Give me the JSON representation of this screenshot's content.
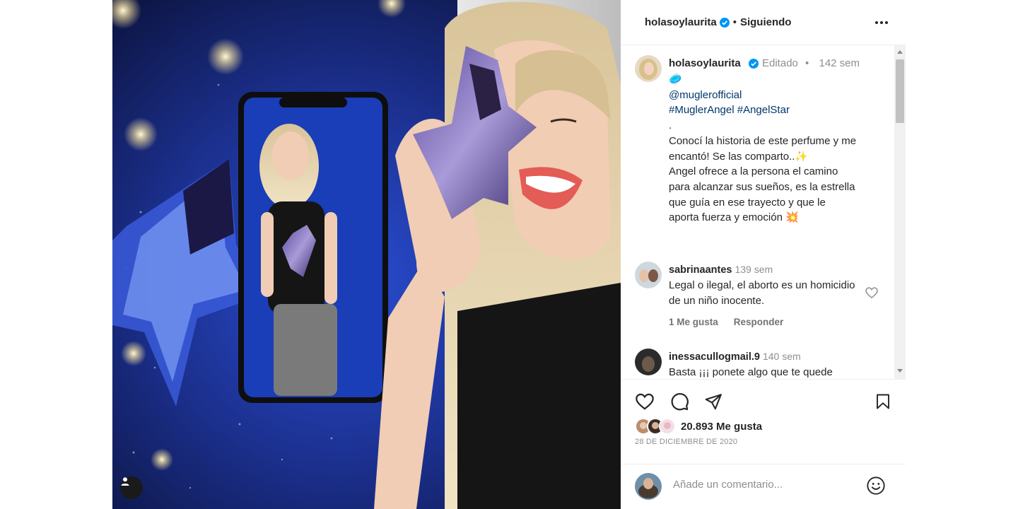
{
  "header": {
    "username": "holasoylaurita",
    "separator": "•",
    "follow_status": "Siguiendo",
    "more_icon": "more-horizontal-icon"
  },
  "caption": {
    "username": "holasoylaurita",
    "edited": "Editado",
    "separator": "•",
    "time": "142 sem",
    "lines": {
      "emoji": "🥏",
      "mention": "@muglerofficial",
      "hashtags": "#MuglerAngel #AngelStar",
      "dot": ".",
      "l1": "Conocí la historia de este perfume y me",
      "l2": "encantó! Se las comparto..✨",
      "l3": "Angel ofrece a la persona el camino",
      "l4": "para alcanzar sus sueños, es la estrella",
      "l5": "que guía en ese trayecto y que le",
      "l6": "aporta fuerza y emoción 💥"
    }
  },
  "comments": [
    {
      "username": "sabrinaantes",
      "time": "139 sem",
      "text": "Legal o ilegal, el aborto es un homicidio de un niño inocente.",
      "likes": "1 Me gusta",
      "reply": "Responder"
    },
    {
      "username": "inessacullogmail.9",
      "time": "140 sem",
      "text": "Basta ¡¡¡ ponete algo que te quede"
    }
  ],
  "actions": {
    "like_icon": "heart-icon",
    "comment_icon": "comment-icon",
    "share_icon": "send-icon",
    "save_icon": "bookmark-icon"
  },
  "likes": {
    "count_label": "20.893 Me gusta"
  },
  "date": "28 DE DICIEMBRE DE 2020",
  "comment_input": {
    "placeholder": "Añade un comentario..."
  },
  "colors": {
    "verified": "#0095f6",
    "text": "#262626",
    "muted": "#8e8e8e",
    "link": "#00376b",
    "photo_bg": "#0b1440"
  }
}
